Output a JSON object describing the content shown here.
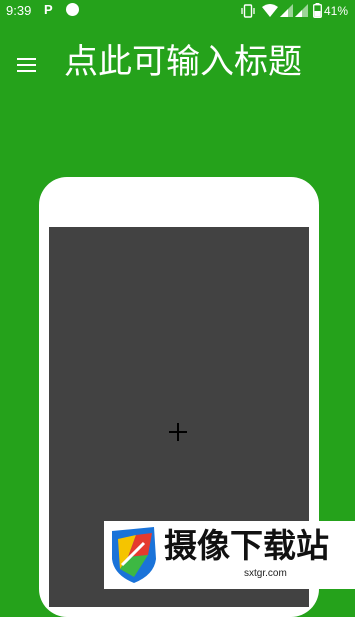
{
  "status_bar": {
    "time": "9:39",
    "notification_letter": "P",
    "battery_percent": "41%",
    "icons": [
      "vibrate-icon",
      "wifi-icon",
      "signal-icon",
      "signal-icon",
      "battery-icon"
    ]
  },
  "toolbar": {
    "menu_icon": "hamburger-menu-icon",
    "title": "点此可输入标题"
  },
  "editor": {
    "add_icon": "plus-icon"
  },
  "watermark": {
    "brand": "摄像下载站",
    "url": "sxtgr.com"
  },
  "colors": {
    "background": "#25a21b",
    "frame": "#ffffff",
    "screen": "#424242",
    "text": "#ffffff"
  }
}
